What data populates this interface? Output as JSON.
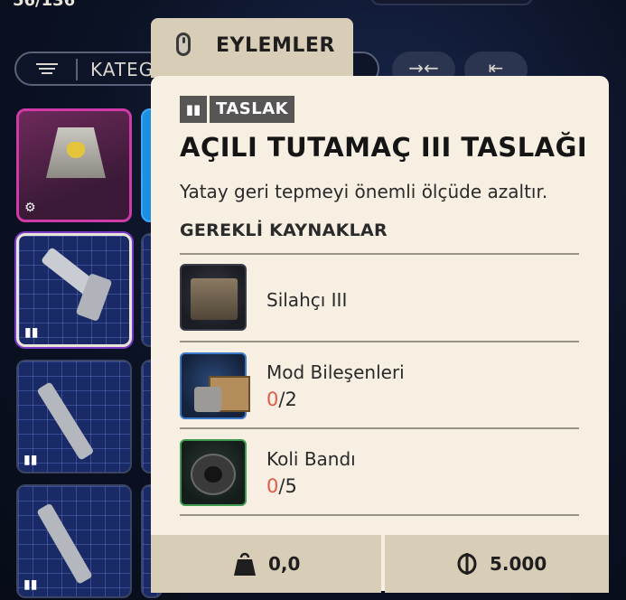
{
  "inventory": {
    "count": "56/136",
    "search_placeholder": "KATEG"
  },
  "tooltip": {
    "tab_title": "EYLEMLER",
    "badge_label": "TASLAK",
    "item_title": "AÇILI TUTAMAÇ III TASLAĞI",
    "item_description": "Yatay geri tepmeyi önemli ölçüde azaltır.",
    "requirements_header": "GEREKLİ KAYNAKLAR",
    "resources": [
      {
        "name": "Silahçı III",
        "have": "",
        "need": ""
      },
      {
        "name": "Mod Bileşenleri",
        "have": "0",
        "need": "/2"
      },
      {
        "name": "Koli Bandı",
        "have": "0",
        "need": "/5"
      }
    ],
    "weight": "0,0",
    "price": "5.000"
  },
  "icons": {
    "mouse": "mouse-icon",
    "blueprint": "book-icon",
    "weight": "weight-icon",
    "currency": "coin-icon",
    "filter": "filter-icon"
  },
  "colors": {
    "panel_bg": "#f6efe2",
    "tab_bg": "#d8cdb7",
    "missing_qty": "#e0594a"
  }
}
